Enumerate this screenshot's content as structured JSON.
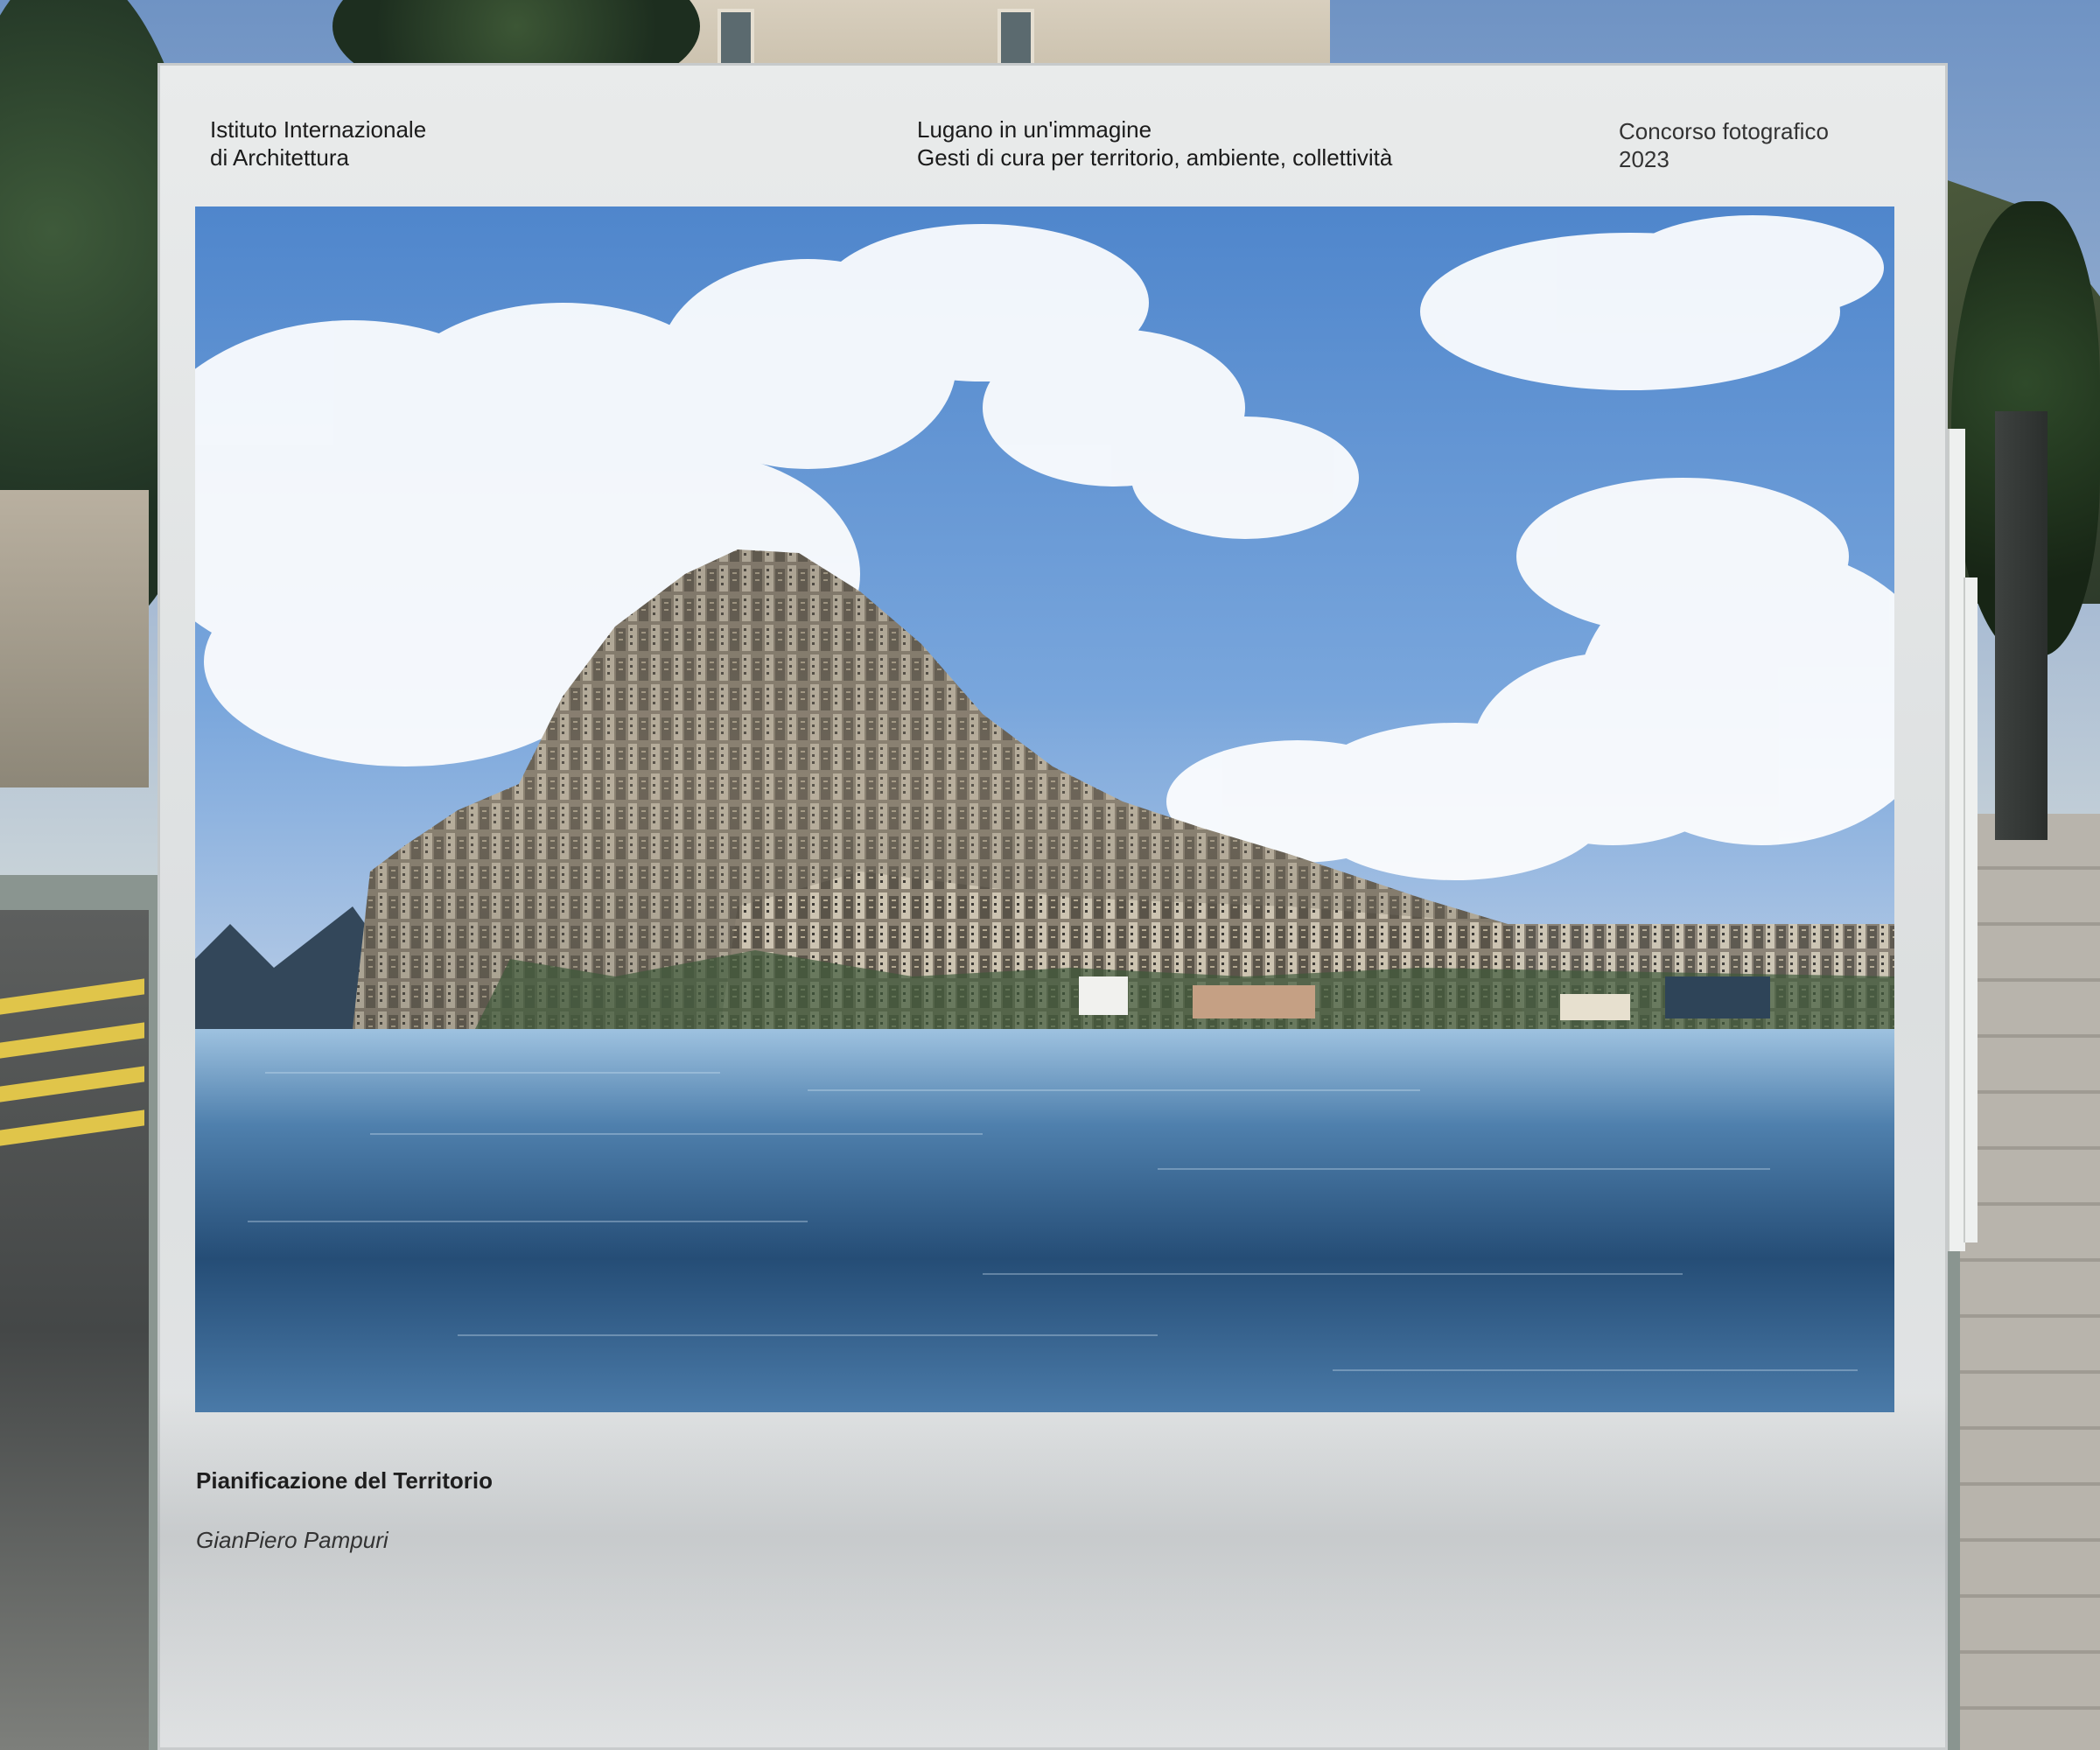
{
  "poster": {
    "organization": {
      "line1": "Istituto Internazionale",
      "line2": "di Architettura"
    },
    "exhibition": {
      "title": "Lugano in un'immagine",
      "subtitle": "Gesti di cura per territorio, ambiente, collettività"
    },
    "contest": {
      "label": "Concorso fotografico",
      "year": "2023"
    },
    "artwork": {
      "title": "Pianificazione del Territorio",
      "author": "GianPiero Pampuri"
    }
  },
  "colors": {
    "board": "#e9ebeb",
    "text": "#1b1b1b",
    "sky": "#5c8fd0",
    "lake": "#3f6f9c"
  }
}
